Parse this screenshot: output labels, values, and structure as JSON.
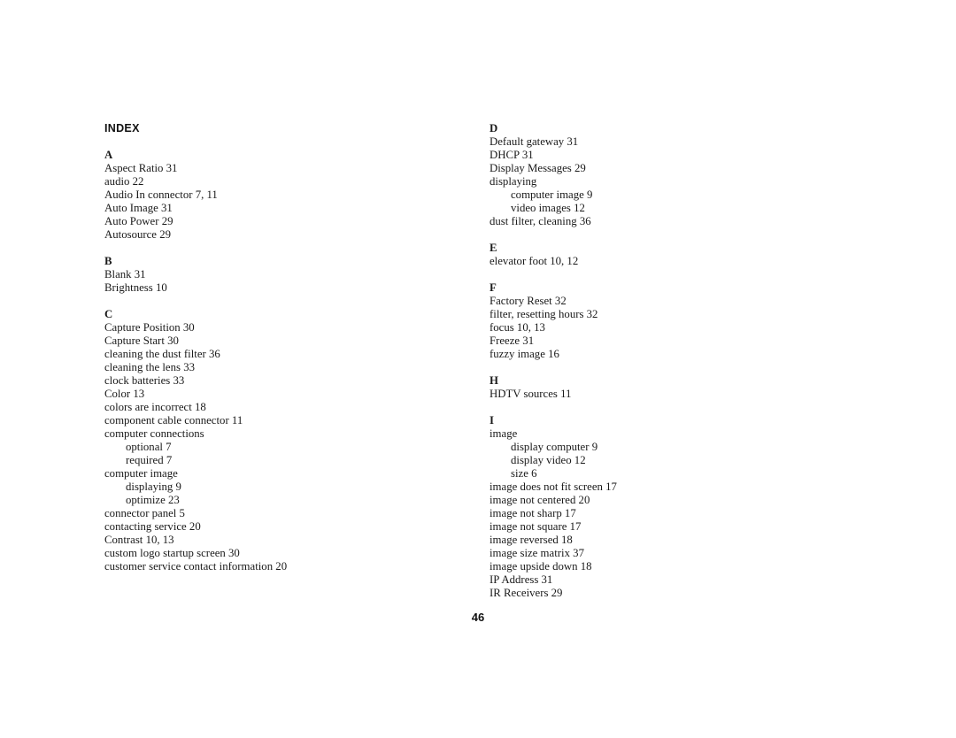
{
  "title": "INDEX",
  "page_number": "46",
  "columns": [
    {
      "sections": [
        {
          "letter": "A",
          "entries": [
            {
              "text": "Aspect Ratio 31",
              "sub": false
            },
            {
              "text": "audio 22",
              "sub": false
            },
            {
              "text": "Audio In connector 7, 11",
              "sub": false
            },
            {
              "text": "Auto Image 31",
              "sub": false
            },
            {
              "text": "Auto Power 29",
              "sub": false
            },
            {
              "text": "Autosource 29",
              "sub": false
            }
          ]
        },
        {
          "letter": "B",
          "entries": [
            {
              "text": "Blank 31",
              "sub": false
            },
            {
              "text": "Brightness 10",
              "sub": false
            }
          ]
        },
        {
          "letter": "C",
          "entries": [
            {
              "text": "Capture Position 30",
              "sub": false
            },
            {
              "text": "Capture Start 30",
              "sub": false
            },
            {
              "text": "cleaning the dust filter 36",
              "sub": false
            },
            {
              "text": "cleaning the lens 33",
              "sub": false
            },
            {
              "text": "clock batteries 33",
              "sub": false
            },
            {
              "text": "Color 13",
              "sub": false
            },
            {
              "text": "colors are incorrect 18",
              "sub": false
            },
            {
              "text": "component cable connector 11",
              "sub": false
            },
            {
              "text": "computer connections",
              "sub": false
            },
            {
              "text": "optional 7",
              "sub": true
            },
            {
              "text": "required 7",
              "sub": true
            },
            {
              "text": "computer image",
              "sub": false
            },
            {
              "text": "displaying 9",
              "sub": true
            },
            {
              "text": "optimize 23",
              "sub": true
            },
            {
              "text": "connector panel 5",
              "sub": false
            },
            {
              "text": "contacting service 20",
              "sub": false
            },
            {
              "text": "Contrast 10, 13",
              "sub": false
            },
            {
              "text": "custom logo startup screen 30",
              "sub": false
            },
            {
              "text": "customer service contact information 20",
              "sub": false
            }
          ]
        }
      ]
    },
    {
      "sections": [
        {
          "letter": "D",
          "entries": [
            {
              "text": "Default gateway 31",
              "sub": false
            },
            {
              "text": "DHCP 31",
              "sub": false
            },
            {
              "text": "Display Messages 29",
              "sub": false
            },
            {
              "text": "displaying",
              "sub": false
            },
            {
              "text": "computer image 9",
              "sub": true
            },
            {
              "text": "video images 12",
              "sub": true
            },
            {
              "text": "dust filter, cleaning 36",
              "sub": false
            }
          ]
        },
        {
          "letter": "E",
          "entries": [
            {
              "text": "elevator foot 10, 12",
              "sub": false
            }
          ]
        },
        {
          "letter": "F",
          "entries": [
            {
              "text": "Factory Reset 32",
              "sub": false
            },
            {
              "text": "filter, resetting hours 32",
              "sub": false
            },
            {
              "text": "focus 10, 13",
              "sub": false
            },
            {
              "text": "Freeze 31",
              "sub": false
            },
            {
              "text": "fuzzy image 16",
              "sub": false
            }
          ]
        },
        {
          "letter": "H",
          "entries": [
            {
              "text": "HDTV sources 11",
              "sub": false
            }
          ]
        },
        {
          "letter": "I",
          "entries": [
            {
              "text": "image",
              "sub": false
            },
            {
              "text": "display computer 9",
              "sub": true
            },
            {
              "text": "display video 12",
              "sub": true
            },
            {
              "text": "size 6",
              "sub": true
            },
            {
              "text": "image does not fit screen 17",
              "sub": false
            },
            {
              "text": "image not centered 20",
              "sub": false
            },
            {
              "text": "image not sharp 17",
              "sub": false
            },
            {
              "text": "image not square 17",
              "sub": false
            },
            {
              "text": "image reversed 18",
              "sub": false
            },
            {
              "text": "image size matrix 37",
              "sub": false
            },
            {
              "text": "image upside down 18",
              "sub": false
            },
            {
              "text": "IP Address 31",
              "sub": false
            },
            {
              "text": "IR Receivers 29",
              "sub": false
            }
          ]
        }
      ]
    }
  ]
}
